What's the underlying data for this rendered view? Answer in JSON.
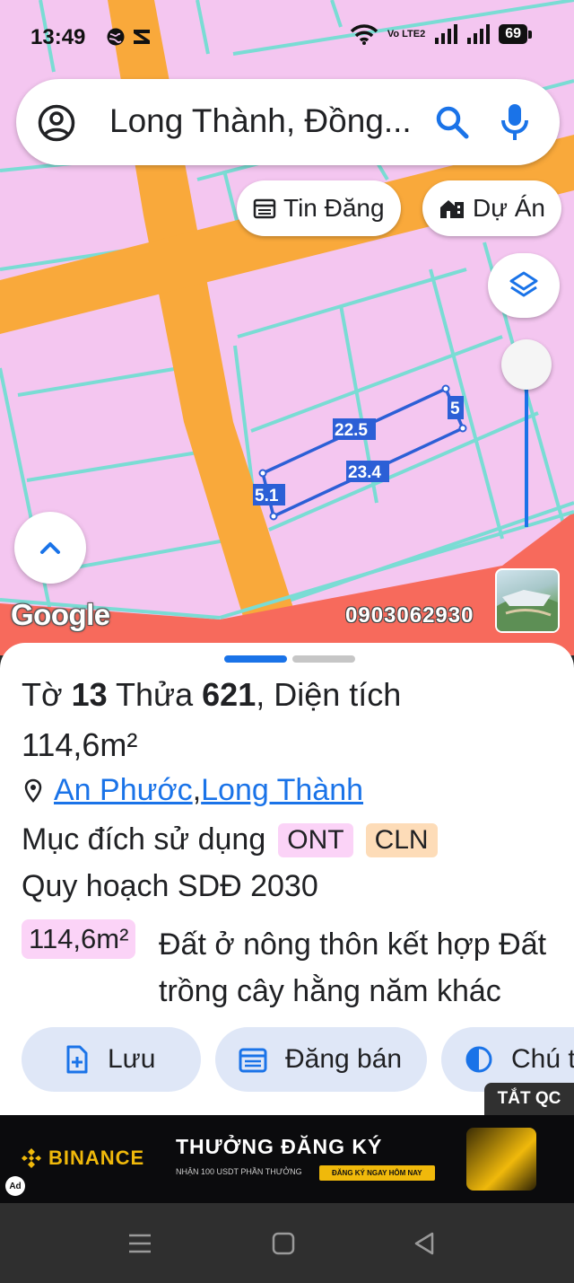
{
  "status_bar": {
    "time": "13:49",
    "network_label": "Vo LTE2",
    "battery": "69"
  },
  "search": {
    "query": "Long Thành, Đồng..."
  },
  "map": {
    "chips": {
      "listings_label": "Tin Đăng",
      "projects_label": "Dự Án"
    },
    "parcel": {
      "edge_top": "22.5",
      "edge_right": "5",
      "edge_bottom": "23.4",
      "edge_left": "5.1"
    },
    "watermark_logo": "Google",
    "watermark_phone": "0903062930"
  },
  "sheet": {
    "title_prefix": "Tờ ",
    "sheet_number": "13",
    "plot_word": " Thửa ",
    "plot_number": "621",
    "area_label": ", Diện tích",
    "area_value": "114,6m²",
    "location": {
      "ward": "An Phước",
      "separator": ", ",
      "district": "Long Thành"
    },
    "land_use_label": "Mục đích sử dụng",
    "land_use_tags": [
      "ONT",
      "CLN"
    ],
    "plan_label": "Quy hoạch SDĐ 2030",
    "plan_area": "114,6m²",
    "plan_description": "Đất ở nông thôn kết hợp Đất trồng cây hằng năm khác",
    "actions": {
      "save": "Lưu",
      "post_sale": "Đăng bán",
      "note": "Chú t"
    }
  },
  "ad": {
    "close_label": "TẮT QC",
    "brand": "BINANCE",
    "headline": "THƯỞNG ĐĂNG KÝ",
    "subtext": "NHẬN 100 USDT PHẦN THƯỞNG",
    "cta": "ĐĂNG KÝ NGAY HÔM NAY",
    "badge": "Ad"
  },
  "colors": {
    "land": "#f4c6f0",
    "road": "#f9a93b",
    "plot_line": "#7adcd4",
    "red_zone": "#f76a5c",
    "parcel": "#2c5fd6",
    "accent": "#1a73e8"
  }
}
